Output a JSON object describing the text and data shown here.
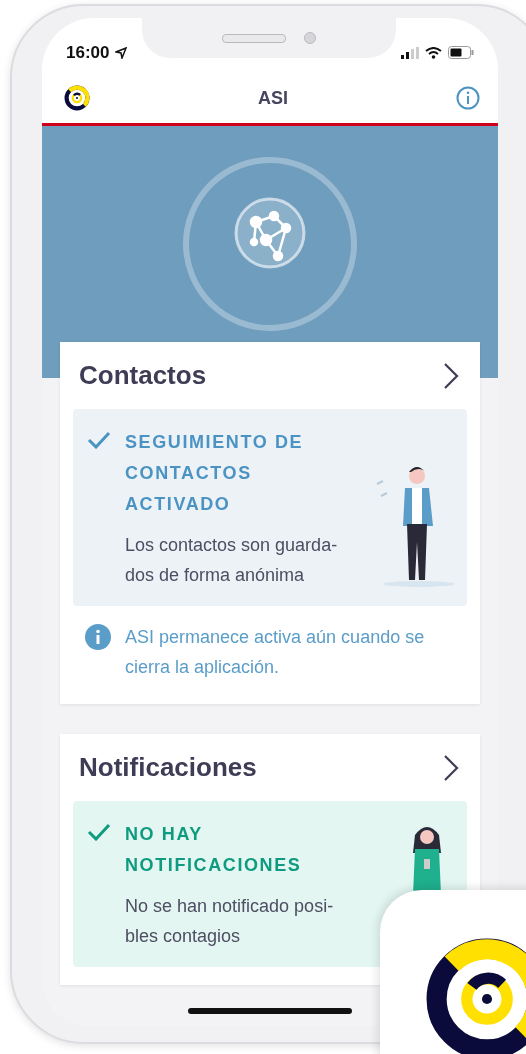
{
  "status_bar": {
    "time": "16:00"
  },
  "header": {
    "title": "ASI"
  },
  "cards": [
    {
      "title": "Contactos",
      "kind": "tracing",
      "status_lines": [
        "SEGUIMIENTO DE",
        "CONTACTOS",
        "ACTIVADO"
      ],
      "text_lines": [
        "Los contactos son guarda-",
        "dos de forma anónima"
      ],
      "note": "ASI permanece activa aún cuando se cierra la aplicación."
    },
    {
      "title": "Notificaciones",
      "kind": "alerts",
      "status_lines": [
        "NO HAY",
        "NOTIFICACIONES"
      ],
      "text_lines": [
        "No se han notificado posi-",
        "bles contagios"
      ]
    }
  ]
}
